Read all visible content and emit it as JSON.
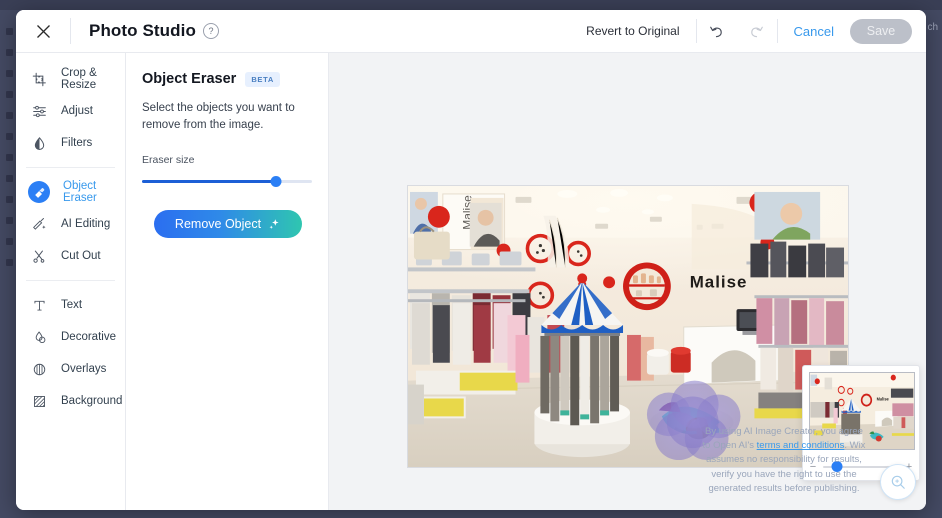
{
  "background": {
    "edge_text": "ch"
  },
  "header": {
    "close_icon": "close-icon",
    "title": "Photo Studio",
    "help_icon": "help-circle-icon",
    "revert_label": "Revert to Original",
    "undo_icon": "undo-icon",
    "redo_icon": "redo-icon",
    "cancel_label": "Cancel",
    "save_label": "Save"
  },
  "sidebar": {
    "groups": [
      {
        "items": [
          {
            "label": "Crop & Resize",
            "icon": "crop-resize-icon",
            "active": false
          },
          {
            "label": "Adjust",
            "icon": "adjust-sliders-icon",
            "active": false
          },
          {
            "label": "Filters",
            "icon": "filters-droplet-icon",
            "active": false
          }
        ]
      },
      {
        "items": [
          {
            "label": "Object Eraser",
            "icon": "object-eraser-icon",
            "active": true
          },
          {
            "label": "AI Editing",
            "icon": "ai-brush-icon",
            "active": false
          },
          {
            "label": "Cut Out",
            "icon": "cut-out-scissors-icon",
            "active": false
          }
        ]
      },
      {
        "items": [
          {
            "label": "Text",
            "icon": "text-icon",
            "active": false
          },
          {
            "label": "Decorative",
            "icon": "decorative-shapes-icon",
            "active": false
          },
          {
            "label": "Overlays",
            "icon": "overlays-icon",
            "active": false
          },
          {
            "label": "Background",
            "icon": "background-pattern-icon",
            "active": false
          }
        ]
      }
    ]
  },
  "panel": {
    "title": "Object Eraser",
    "badge": "BETA",
    "description": "Select the objects you want to remove from the image.",
    "slider_label": "Eraser size",
    "slider_value_pct": 79,
    "remove_label": "Remove Object",
    "remove_icon": "sparkle-icon"
  },
  "canvas": {
    "image_alt": "Malise children's clothing store interior",
    "store_sign": "Malise",
    "selection_mask_color": "#8c7fc8",
    "minimap": {
      "zoom_out_icon": "minus-icon",
      "zoom_in_icon": "plus-icon",
      "zoom_value_pct": 18
    },
    "magnify_button_icon": "magnifier-icon"
  },
  "footer": {
    "text_before": "By using AI Image Creator, you agree to Open AI's ",
    "link": "terms and conditions",
    "text_after": ". Wix assumes no responsibility for results, verify you have the right to use the generated results before publishing."
  },
  "colors": {
    "accent": "#3899ec",
    "active_blue": "#2b7ff5",
    "gradient_start": "#2b6ef0",
    "gradient_end": "#2fc6b0",
    "save_disabled": "#bcc0c9",
    "backdrop": "#444a63"
  }
}
